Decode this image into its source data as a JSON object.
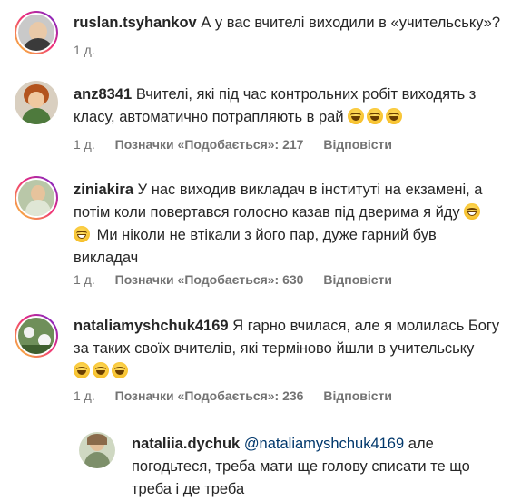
{
  "comments": [
    {
      "username": "ruslan.tsyhankov",
      "text": "А у вас вчителі виходили в «учительську»?",
      "time": "1 д."
    },
    {
      "username": "anz8341",
      "text_line1": "Вчителі, які під час контрольних робіт виходять з",
      "text_line2": "класу, автоматично потрапляють в рай",
      "time": "1 д.",
      "likes": "Позначки «Подобається»: 217",
      "reply": "Відповісти"
    },
    {
      "username": "ziniakira",
      "text_line1": "У нас виходив викладач в інституті на екзамені, а",
      "text_line2": "потім коли повертався голосно казав під дверима я йду",
      "text_line3": "Ми ніколи не втікали з його пар, дуже гарний був",
      "text_line4": "викладач",
      "time": "1 д.",
      "likes": "Позначки «Подобається»: 630",
      "reply": "Відповісти"
    },
    {
      "username": "nataliamyshchuk4169",
      "text_line1": "Я гарно вчилася, але я молилась Богу",
      "text_line2": "за таких своїх вчителів, які терміново йшли в учительську",
      "time": "1 д.",
      "likes": "Позначки «Подобається»: 236",
      "reply": "Відповісти"
    },
    {
      "username": "nataliia.dychuk",
      "mention": "@nataliamyshchuk4169",
      "text_line1": "але",
      "text_line2": "погодьтеся, треба мати ще голову списати те що",
      "text_line3": "треба і де треба"
    }
  ],
  "colors": {
    "text": "#262626",
    "meta": "#737373",
    "mention": "#00376b"
  }
}
